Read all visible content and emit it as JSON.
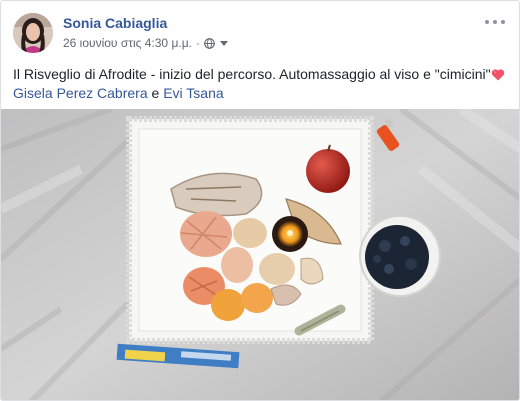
{
  "post": {
    "author": "Sonia Cabiaglia",
    "timestamp": "26 ιουνίου στις 4:30 μ.μ.",
    "separator": "·",
    "privacy_icon": "globe-icon",
    "text_before": "Il Risveglio di Afrodite - inizio del percorso. Automassaggio al viso e \"cimicini\"",
    "heart_icon": "heart-emoji",
    "tag_1": "Gisela Perez Cabrera",
    "conjunction": " e ",
    "tag_2": "Evi Tsana"
  },
  "colors": {
    "link": "#365899",
    "meta": "#616770",
    "heart": "#f25268"
  }
}
